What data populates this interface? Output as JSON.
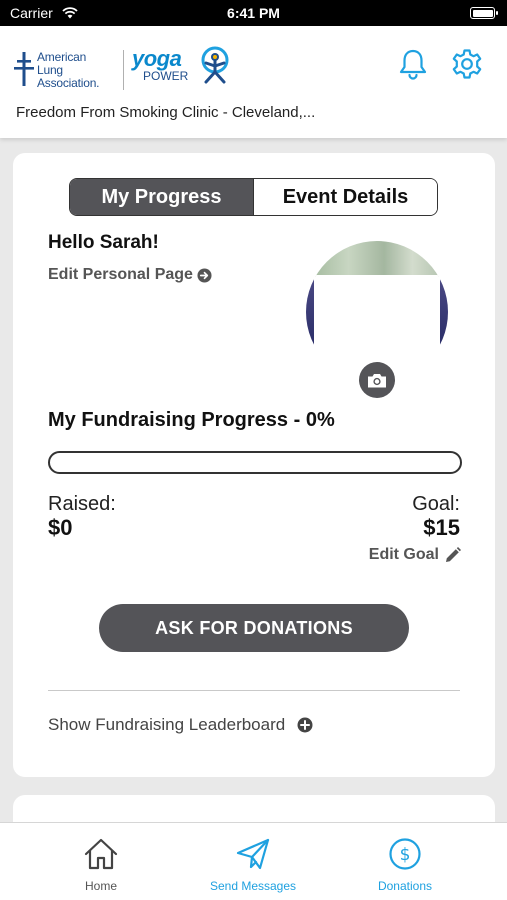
{
  "status_bar": {
    "carrier": "Carrier",
    "time": "6:41 PM"
  },
  "header": {
    "ala_logo_lines": [
      "American",
      "Lung",
      "Association."
    ],
    "yoga_word": "yoga",
    "power_word": "POWER",
    "clinic_name": "Freedom From Smoking Clinic - Cleveland,..."
  },
  "segment": {
    "active": "My Progress",
    "inactive": "Event Details"
  },
  "profile": {
    "greeting": "Hello Sarah!",
    "edit_page": "Edit Personal Page"
  },
  "fundraising": {
    "title": "My Fundraising Progress - 0%",
    "progress_percent": 0,
    "raised_label": "Raised:",
    "raised_value": "$0",
    "goal_label": "Goal:",
    "goal_value": "$15",
    "edit_goal": "Edit Goal",
    "ask_button": "ASK FOR DONATIONS",
    "leaderboard_link": "Show Fundraising Leaderboard"
  },
  "tabbar": {
    "home": "Home",
    "send": "Send Messages",
    "donations": "Donations"
  },
  "colors": {
    "accent": "#1fa1e0",
    "dark_button": "#545458",
    "ala_blue": "#1f4e8c"
  },
  "icons": [
    "wifi-icon",
    "battery-icon",
    "bell-icon",
    "gear-icon",
    "arrow-right-circle-icon",
    "camera-icon",
    "pencil-icon",
    "plus-circle-icon",
    "home-icon",
    "paper-plane-icon",
    "dollar-circle-icon"
  ]
}
